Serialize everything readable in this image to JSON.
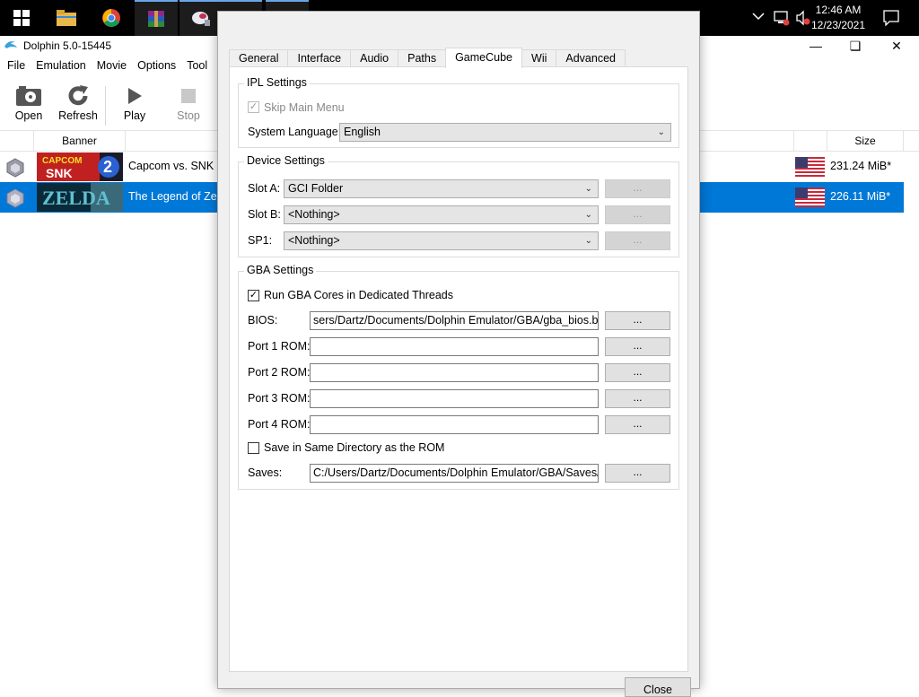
{
  "taskbar": {
    "icons": [
      "windows-start-icon",
      "file-explorer-icon",
      "chrome-icon",
      "winrar-icon",
      "app-icon",
      "dolphin-config-icon",
      "dolphin-icon"
    ],
    "clock": {
      "time": "12:46 AM",
      "date": "12/23/2021"
    }
  },
  "window": {
    "title": "Dolphin 5.0-15445",
    "menu": [
      "File",
      "Emulation",
      "Movie",
      "Options",
      "Tool"
    ]
  },
  "toolbar": {
    "open": "Open",
    "refresh": "Refresh",
    "play": "Play",
    "stop": "Stop"
  },
  "gamelist": {
    "columns": {
      "banner": "Banner",
      "size": "Size"
    },
    "rows": [
      {
        "title": "Capcom vs. SNK 2",
        "size": "231.24 MiB*"
      },
      {
        "title": "The Legend of Zelc",
        "size": "226.11 MiB*"
      }
    ]
  },
  "dialog": {
    "tabs": [
      "General",
      "Interface",
      "Audio",
      "Paths",
      "GameCube",
      "Wii",
      "Advanced"
    ],
    "active_tab": "GameCube",
    "ipl": {
      "title": "IPL Settings",
      "skip_main_menu": "Skip Main Menu",
      "system_language_label": "System Language:",
      "system_language_value": "English"
    },
    "device": {
      "title": "Device Settings",
      "slot_a_label": "Slot A:",
      "slot_a_value": "GCI Folder",
      "slot_b_label": "Slot B:",
      "slot_b_value": "<Nothing>",
      "sp1_label": "SP1:",
      "sp1_value": "<Nothing>",
      "browse": "..."
    },
    "gba": {
      "title": "GBA Settings",
      "run_cores": "Run GBA Cores in Dedicated Threads",
      "bios_label": "BIOS:",
      "bios_value": "sers/Dartz/Documents/Dolphin Emulator/GBA/gba_bios.bin",
      "port1_label": "Port 1 ROM:",
      "port2_label": "Port 2 ROM:",
      "port3_label": "Port 3 ROM:",
      "port4_label": "Port 4 ROM:",
      "same_dir": "Save in Same Directory as the ROM",
      "saves_label": "Saves:",
      "saves_value": "C:/Users/Dartz/Documents/Dolphin Emulator/GBA/Saves/",
      "browse": "..."
    },
    "close": "Close"
  }
}
